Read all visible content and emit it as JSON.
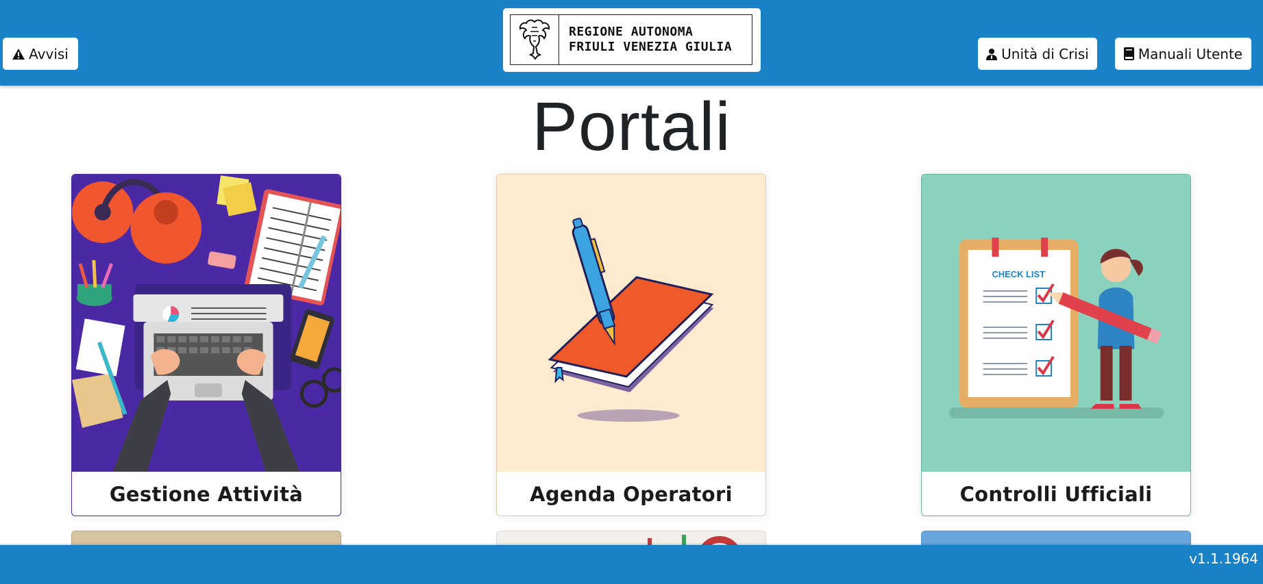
{
  "header": {
    "avvisi_label": "Avvisi",
    "crisi_label": "Unità di Crisi",
    "manuali_label": "Manuali Utente",
    "logo_line1": "REGIONE AUTONOMA",
    "logo_line2": "FRIULI VENEZIA GIULIA"
  },
  "page_title": "Portali",
  "cards": [
    {
      "label": "Gestione Attività",
      "bg": "#4b29a4"
    },
    {
      "label": "Agenda Operatori",
      "bg": "#fdebd0"
    },
    {
      "label": "Controlli Ufficiali",
      "bg": "#8bd2be",
      "checklist_title": "CHECK LIST"
    }
  ],
  "footer": {
    "version": "v1.1.1964"
  },
  "colors": {
    "bar": "#1a82c7"
  }
}
